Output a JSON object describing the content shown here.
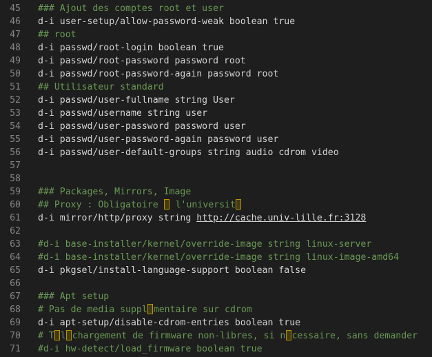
{
  "editor": {
    "lines": [
      {
        "n": "45",
        "type": "comment",
        "text": "### Ajout des comptes root et user"
      },
      {
        "n": "46",
        "type": "code",
        "text": "d-i user-setup/allow-password-weak boolean true"
      },
      {
        "n": "47",
        "type": "comment",
        "text": "## root"
      },
      {
        "n": "48",
        "type": "code",
        "text": "d-i passwd/root-login boolean true"
      },
      {
        "n": "49",
        "type": "code",
        "text": "d-i passwd/root-password password root"
      },
      {
        "n": "50",
        "type": "code",
        "text": "d-i passwd/root-password-again password root"
      },
      {
        "n": "51",
        "type": "comment",
        "text": "## Utilisateur standard"
      },
      {
        "n": "52",
        "type": "code",
        "text": "d-i passwd/user-fullname string User"
      },
      {
        "n": "53",
        "type": "code",
        "text": "d-i passwd/username string user"
      },
      {
        "n": "54",
        "type": "code",
        "text": "d-i passwd/user-password password user"
      },
      {
        "n": "55",
        "type": "code",
        "text": "d-i passwd/user-password-again password user"
      },
      {
        "n": "56",
        "type": "code",
        "text": "d-i passwd/user-default-groups string audio cdrom video"
      },
      {
        "n": "57",
        "type": "blank",
        "text": ""
      },
      {
        "n": "58",
        "type": "blank",
        "text": ""
      },
      {
        "n": "59",
        "type": "comment",
        "text": "### Packages, Mirrors, Image"
      },
      {
        "n": "60",
        "type": "comment-marks",
        "parts": [
          "## Proxy : Obligatoire ",
          " l'universit",
          ""
        ]
      },
      {
        "n": "61",
        "type": "code-link",
        "text": "d-i mirror/http/proxy string ",
        "link": "http://cache.univ-lille.fr:3128"
      },
      {
        "n": "62",
        "type": "blank",
        "text": ""
      },
      {
        "n": "63",
        "type": "comment",
        "text": "#d-i base-installer/kernel/override-image string linux-server"
      },
      {
        "n": "64",
        "type": "comment",
        "text": "#d-i base-installer/kernel/override-image string linux-image-amd64"
      },
      {
        "n": "65",
        "type": "code",
        "text": "d-i pkgsel/install-language-support boolean false"
      },
      {
        "n": "66",
        "type": "blank",
        "text": ""
      },
      {
        "n": "67",
        "type": "comment",
        "text": "### Apt setup"
      },
      {
        "n": "68",
        "type": "comment-marks",
        "parts": [
          "# Pas de media suppl",
          "mentaire sur cdrom"
        ]
      },
      {
        "n": "69",
        "type": "code",
        "text": "d-i apt-setup/disable-cdrom-entries boolean true"
      },
      {
        "n": "70",
        "type": "comment-marks",
        "parts": [
          "# T",
          "l",
          "chargement de firmware non-libres, si n",
          "cessaire, sans demander"
        ]
      },
      {
        "n": "71",
        "type": "comment",
        "text": "#d-i hw-detect/load_firmware boolean true"
      }
    ]
  },
  "colors": {
    "background": "#1e1e1e",
    "line_number": "#858585",
    "code_text": "#d4d4d4",
    "comment": "#6a9955",
    "invalid_char_highlight": "#b89500"
  }
}
